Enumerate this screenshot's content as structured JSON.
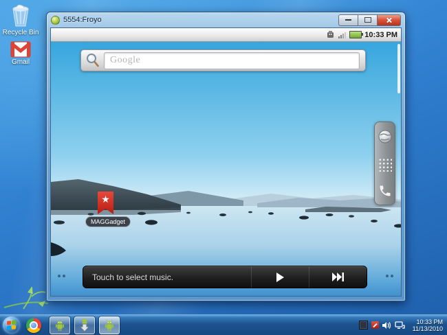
{
  "desktop": {
    "icons": [
      {
        "label": "Recycle Bin"
      },
      {
        "label": "Gmail"
      }
    ]
  },
  "emulator": {
    "title": "5554:Froyo",
    "status_bar": {
      "time": "10:33 PM"
    },
    "home": {
      "search": {
        "placeholder": "Google"
      },
      "shortcut": {
        "label": "MAGGadget"
      },
      "music": {
        "prompt": "Touch to select music."
      }
    }
  },
  "taskbar": {
    "clock": {
      "time": "10:33 PM",
      "date": "11/13/2010"
    }
  },
  "icons": {
    "minimize": "dash",
    "maximize": "box",
    "close": "x",
    "play": "triangle",
    "next": "skip-next",
    "launcher": [
      "globe-browser",
      "app-drawer-grid",
      "phone"
    ],
    "status": [
      "usb-debug",
      "signal-bars",
      "battery"
    ]
  },
  "colors": {
    "desktop_top": "#46a0e4",
    "desktop_bottom": "#1e5fab",
    "battery_green": "#6fae2e",
    "gmail_red": "#db4437",
    "ribbon_red": "#d2281e",
    "android_green": "#a4c639",
    "taskbar_blue": "#1c538f"
  }
}
